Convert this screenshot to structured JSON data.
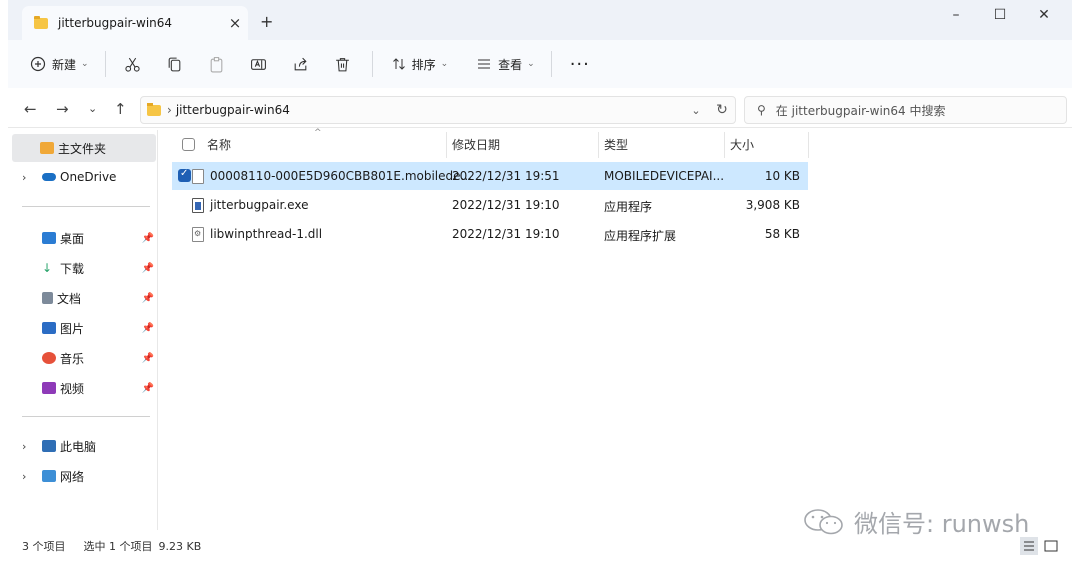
{
  "window": {
    "tab_title": "jitterbugpair-win64",
    "tab_close": "×",
    "new_tab": "+",
    "minimize": "–",
    "maximize": "☐",
    "close": "✕"
  },
  "toolbar": {
    "new_label": "新建",
    "sort_label": "排序",
    "view_label": "查看",
    "more_label": "···",
    "icons": [
      "cut-icon",
      "copy-icon",
      "paste-icon",
      "rename-icon",
      "share-icon",
      "delete-icon"
    ]
  },
  "address": {
    "path_separator": "›",
    "path": "jitterbugpair-win64",
    "search_placeholder": "在 jitterbugpair-win64 中搜索"
  },
  "sidebar": {
    "home": "主文件夹",
    "onedrive": "OneDrive",
    "quick_access": [
      {
        "label": "桌面",
        "icon": "desktop-icon",
        "color": "#2b7cd3"
      },
      {
        "label": "下载",
        "icon": "download-icon",
        "color": "#26a269"
      },
      {
        "label": "文档",
        "icon": "documents-icon",
        "color": "#7d8a9a"
      },
      {
        "label": "图片",
        "icon": "pictures-icon",
        "color": "#2b6cc4"
      },
      {
        "label": "音乐",
        "icon": "music-icon",
        "color": "#e6513a"
      },
      {
        "label": "视频",
        "icon": "videos-icon",
        "color": "#8e3ab8"
      }
    ],
    "this_pc": "此电脑",
    "network": "网络"
  },
  "columns": {
    "name": "名称",
    "modified": "修改日期",
    "type": "类型",
    "size": "大小"
  },
  "files": [
    {
      "name": "00008110-000E5D960CBB801E.mobilede...",
      "modified": "2022/12/31 19:51",
      "type": "MOBILEDEVICEPAI...",
      "size": "10 KB",
      "selected": true,
      "icon": "generic-file-icon"
    },
    {
      "name": "jitterbugpair.exe",
      "modified": "2022/12/31 19:10",
      "type": "应用程序",
      "size": "3,908 KB",
      "selected": false,
      "icon": "exe-file-icon"
    },
    {
      "name": "libwinpthread-1.dll",
      "modified": "2022/12/31 19:10",
      "type": "应用程序扩展",
      "size": "58 KB",
      "selected": false,
      "icon": "dll-file-icon"
    }
  ],
  "status": {
    "item_count": "3 个项目",
    "selection": "选中 1 个项目",
    "selection_size": "9.23 KB"
  },
  "watermark": "微信号: runwsh",
  "colors": {
    "selection": "#cde8ff",
    "accent": "#1e5fb4",
    "folder": "#f6c545"
  }
}
